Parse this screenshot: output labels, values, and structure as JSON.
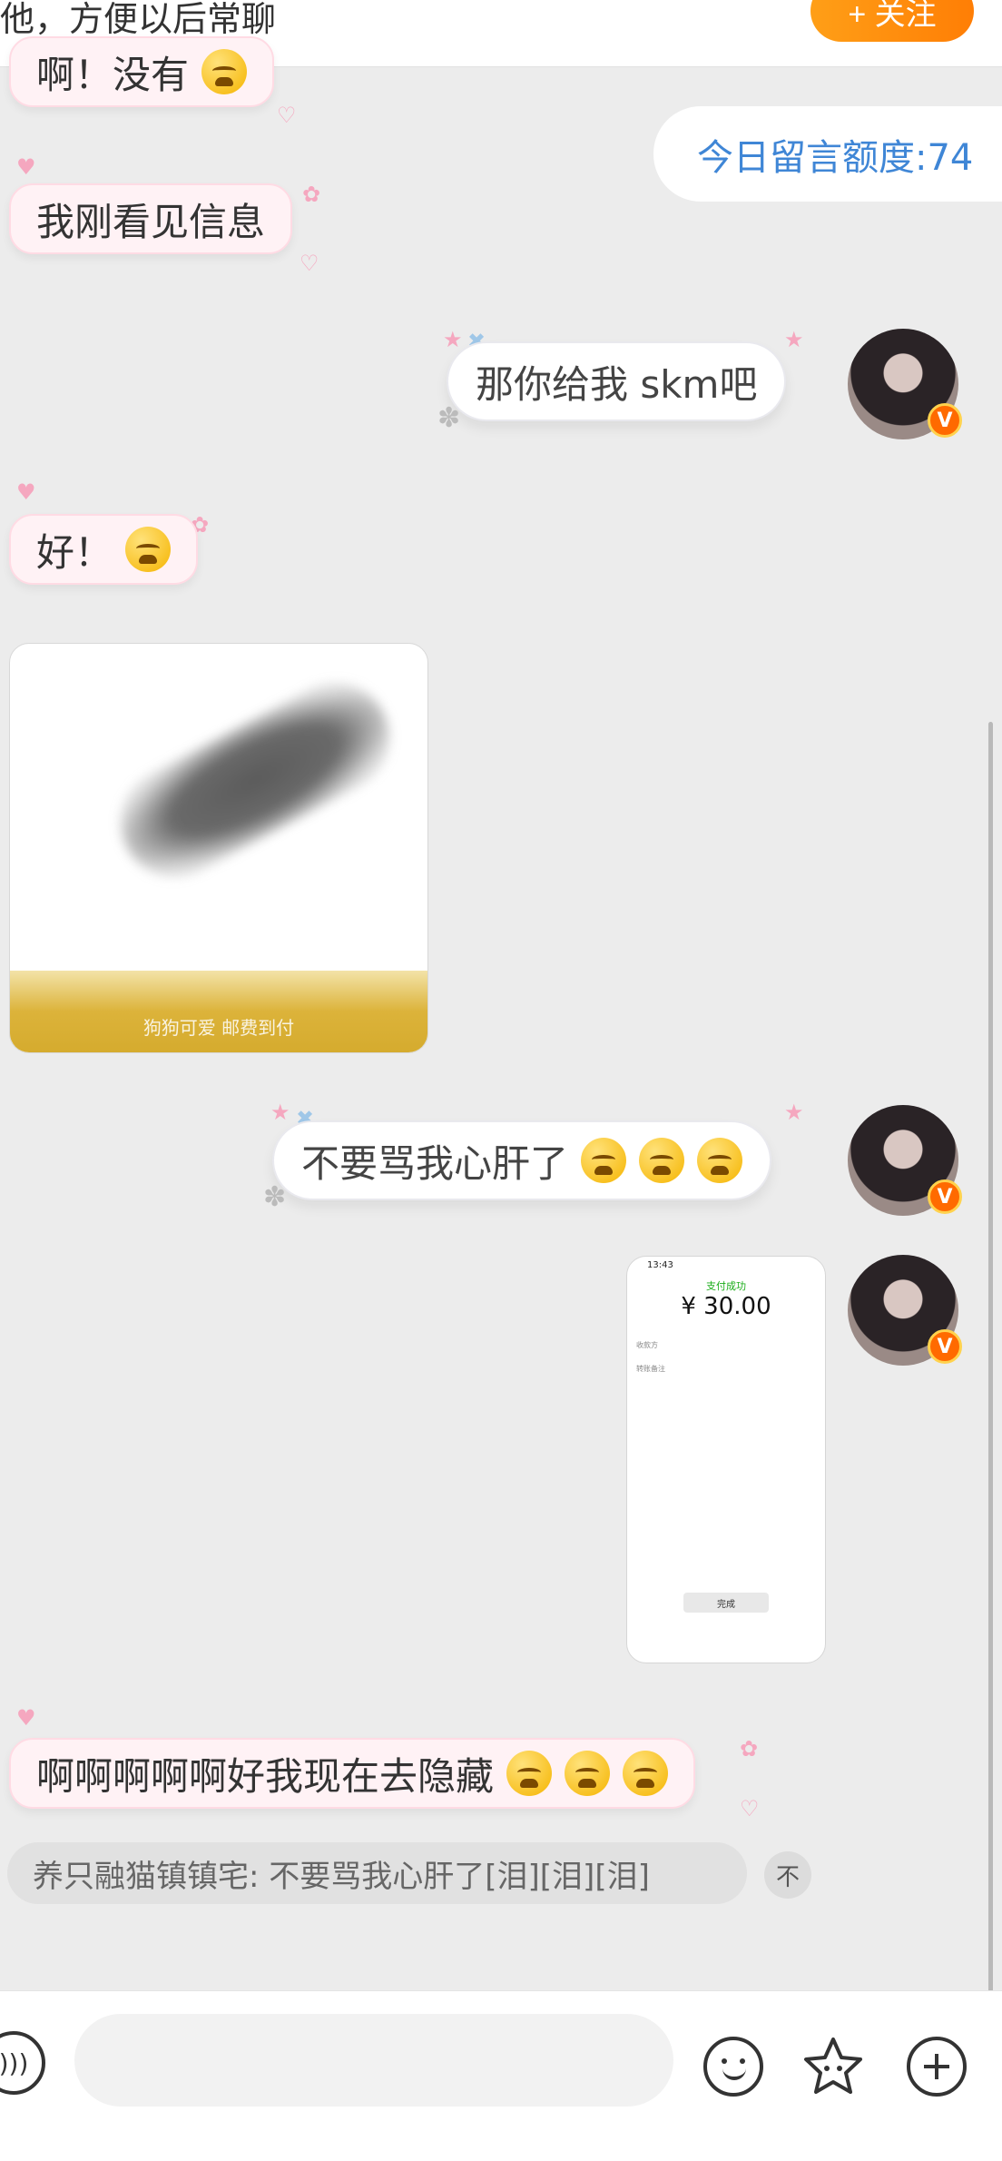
{
  "topbar": {
    "hint": "他，方便以后常聊",
    "follow_label": "+ 关注"
  },
  "quota": {
    "label": "今日留言额度:74"
  },
  "messages": {
    "m1": "啊！没有",
    "m2": "我刚看见信息",
    "m3": "那你给我 skm吧",
    "m4": "好！",
    "m6": "不要骂我心肝了",
    "m8": "啊啊啊啊啊好我现在去隐藏"
  },
  "photo": {
    "caption": "狗狗可爱 邮费到付"
  },
  "payshot": {
    "status_time": "13:43",
    "success_label": "支付成功",
    "amount": "¥ 30.00",
    "payee_label": "收款方",
    "note_label": "转账备注",
    "done_label": "完成"
  },
  "quote": {
    "text": "养只融猫镇镇宅: 不要骂我心肝了[泪][泪][泪]",
    "toggle_glyph": "不"
  },
  "avatar": {
    "badge": "V"
  },
  "bottombar": {
    "input_placeholder": "",
    "icons": [
      "voice-icon",
      "emoji-icon",
      "sticker-icon",
      "plus-icon"
    ]
  },
  "colors": {
    "accent_orange": "#ff8a0e",
    "quota_blue": "#3f86d6",
    "pink_bubble": "#fff2f5",
    "background": "#ececec"
  }
}
